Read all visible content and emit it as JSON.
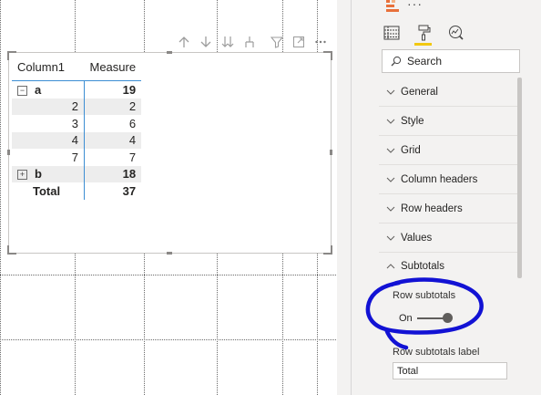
{
  "visual_toolbar": {
    "icons": [
      "drill-up-icon",
      "drill-down-icon",
      "expand-all-icon",
      "expand-hierarchy-icon",
      "filter-icon",
      "focus-mode-icon",
      "more-options-icon"
    ]
  },
  "matrix": {
    "columns": [
      "Column1",
      "Measure"
    ],
    "rows": [
      {
        "label": "a",
        "value": "19",
        "kind": "parent",
        "expander": "⊟"
      },
      {
        "label": "2",
        "value": "2",
        "kind": "child"
      },
      {
        "label": "3",
        "value": "6",
        "kind": "child"
      },
      {
        "label": "4",
        "value": "4",
        "kind": "child"
      },
      {
        "label": "7",
        "value": "7",
        "kind": "child"
      },
      {
        "label": "b",
        "value": "18",
        "kind": "parent",
        "expander": "⊞"
      },
      {
        "label": "Total",
        "value": "37",
        "kind": "total"
      }
    ]
  },
  "pane": {
    "more_label": "···",
    "tabs": [
      "fields-icon",
      "format-paintbrush-icon",
      "analytics-icon"
    ],
    "active_tab": "format-paintbrush-icon",
    "search": {
      "placeholder": "Search"
    },
    "sections": [
      "General",
      "Style",
      "Grid",
      "Column headers",
      "Row headers",
      "Values",
      "Subtotals"
    ],
    "row_subtotals": {
      "label": "Row subtotals",
      "state": "On"
    },
    "row_subtotals_label": {
      "label": "Row subtotals label",
      "value": "Total"
    }
  },
  "colors": {
    "accent_yellow": "#f2c811",
    "header_rule": "#3c8ed3",
    "annotation_blue": "#1212d4",
    "brand_orange": "#e8703a"
  }
}
